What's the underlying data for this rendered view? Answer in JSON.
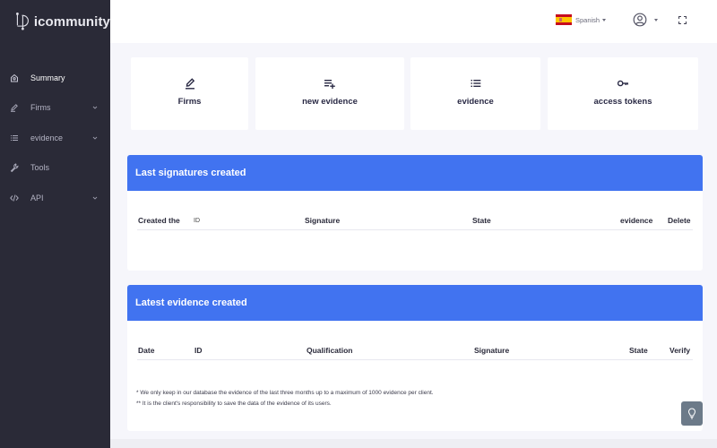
{
  "app": {
    "brand": "icommunity"
  },
  "sidebar": {
    "items": [
      {
        "label": "Summary",
        "icon": "home-icon",
        "active": true,
        "expandable": false
      },
      {
        "label": "Firms",
        "icon": "pen-icon",
        "active": false,
        "expandable": true
      },
      {
        "label": "evidence",
        "icon": "list-icon",
        "active": false,
        "expandable": true
      },
      {
        "label": "Tools",
        "icon": "wrench-icon",
        "active": false,
        "expandable": false
      },
      {
        "label": "API",
        "icon": "code-icon",
        "active": false,
        "expandable": true
      }
    ]
  },
  "topbar": {
    "language": "Spanish",
    "language_flag": "spain-flag-icon",
    "user_icon": "user-circle-icon",
    "fullscreen_icon": "fullscreen-icon"
  },
  "shortcuts": [
    {
      "label": "Firms",
      "icon": "pen-icon"
    },
    {
      "label": "new evidence",
      "icon": "playlist-add-icon"
    },
    {
      "label": "evidence",
      "icon": "list-icon"
    },
    {
      "label": "access tokens",
      "icon": "key-icon"
    }
  ],
  "signatures_panel": {
    "title": "Last signatures created",
    "columns": [
      "Created the",
      "ID",
      "Signature",
      "State",
      "evidence",
      "Delete"
    ],
    "rows": []
  },
  "evidence_panel": {
    "title": "Latest evidence created",
    "columns": [
      "Date",
      "ID",
      "Qualification",
      "Signature",
      "State",
      "Verify"
    ],
    "rows": [],
    "notes": [
      "* We only keep in our database the evidence of the last three months up to a maximum of 1000 evidence per client.",
      "** It is the client's responsibility to save the data of the evidence of its users."
    ]
  },
  "help_button": {
    "icon": "lightbulb-icon"
  },
  "colors": {
    "sidebar_bg": "#2a2a37",
    "accent_blue": "#4173f0",
    "page_bg": "#f6f6fb",
    "help_button_bg": "#6c7a89"
  }
}
